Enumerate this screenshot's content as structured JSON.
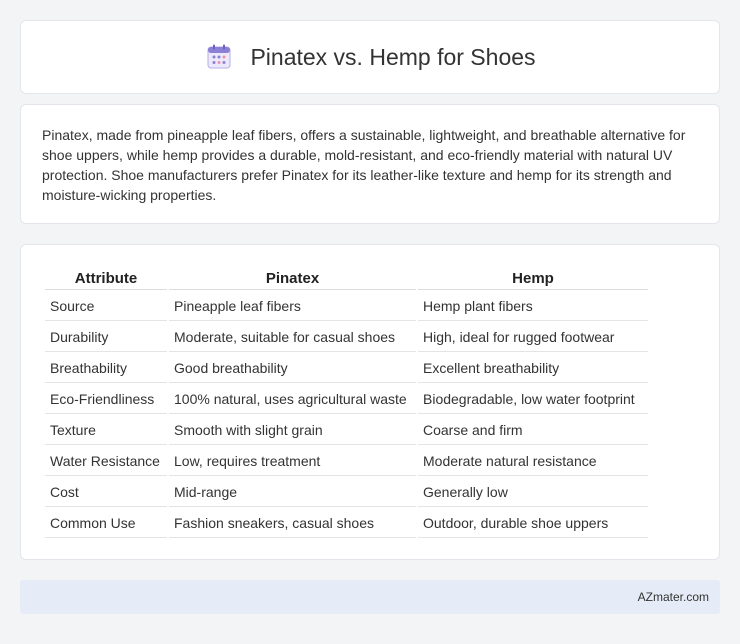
{
  "header": {
    "title": "Pinatex vs. Hemp for Shoes",
    "icon": "calendar-icon"
  },
  "description": "Pinatex, made from pineapple leaf fibers, offers a sustainable, lightweight, and breathable alternative for shoe uppers, while hemp provides a durable, mold-resistant, and eco-friendly material with natural UV protection. Shoe manufacturers prefer Pinatex for its leather-like texture and hemp for its strength and moisture-wicking properties.",
  "table": {
    "headers": [
      "Attribute",
      "Pinatex",
      "Hemp"
    ],
    "rows": [
      [
        "Source",
        "Pineapple leaf fibers",
        "Hemp plant fibers"
      ],
      [
        "Durability",
        "Moderate, suitable for casual shoes",
        "High, ideal for rugged footwear"
      ],
      [
        "Breathability",
        "Good breathability",
        "Excellent breathability"
      ],
      [
        "Eco-Friendliness",
        "100% natural, uses agricultural waste",
        "Biodegradable, low water footprint"
      ],
      [
        "Texture",
        "Smooth with slight grain",
        "Coarse and firm"
      ],
      [
        "Water Resistance",
        "Low, requires treatment",
        "Moderate natural resistance"
      ],
      [
        "Cost",
        "Mid-range",
        "Generally low"
      ],
      [
        "Common Use",
        "Fashion sneakers, casual shoes",
        "Outdoor, durable shoe uppers"
      ]
    ]
  },
  "footer": {
    "site": "AZmater.com"
  },
  "colors": {
    "page_bg": "#f3f4f6",
    "footer_bg": "#e6ecf7",
    "icon_purple": "#8b7fd6",
    "icon_pink": "#f08fb0"
  }
}
